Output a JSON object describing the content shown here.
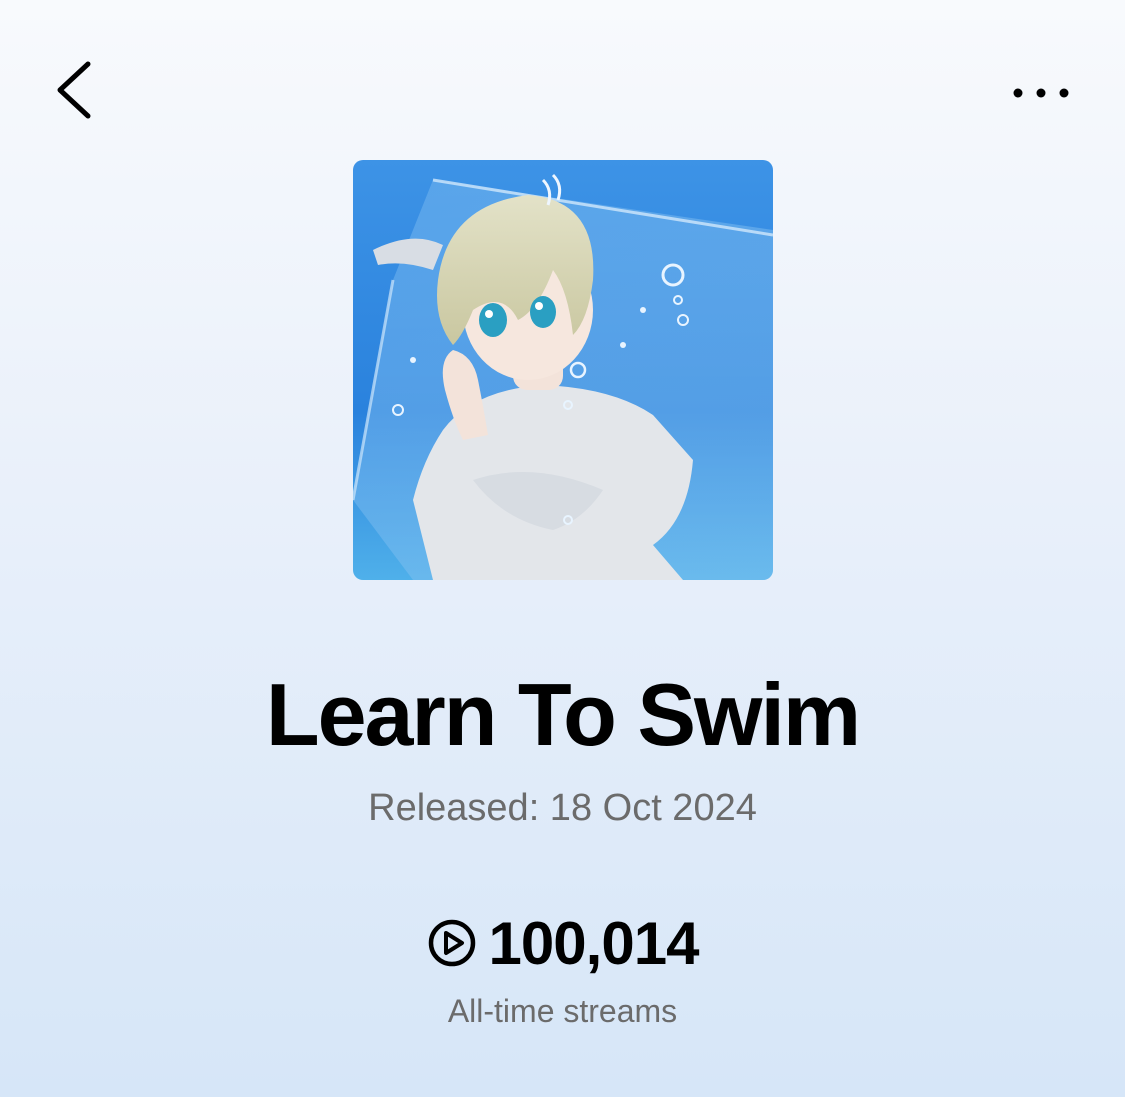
{
  "header": {
    "back_icon": "chevron-left-icon",
    "more_icon": "more-horizontal-icon"
  },
  "cover": {
    "accent_colors": [
      "#2f86e0",
      "#5aa6ea",
      "#dfe3e8",
      "#d9d2a8"
    ]
  },
  "track": {
    "title": "Learn To Swim",
    "released": "Released: 18 Oct 2024"
  },
  "stats": {
    "icon": "play-circle-icon",
    "count": "100,014",
    "label": "All-time streams"
  }
}
